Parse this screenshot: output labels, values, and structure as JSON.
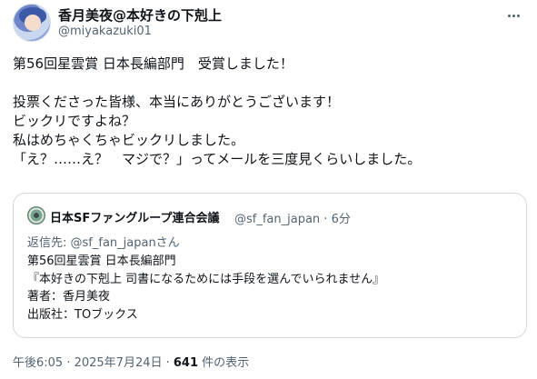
{
  "header": {
    "display_name": "香月美夜@本好きの下剋上",
    "handle": "@miyakazuki01",
    "more_icon": "more-horizontal-icon"
  },
  "tweet": {
    "lines": [
      "第56回星雲賞 日本長編部門　受賞しました！",
      "",
      "投票くださった皆様、本当にありがとうございます！",
      "ビックリですよね？",
      "私はめちゃくちゃビックリしました。",
      "「え？……え？　マジで？」ってメールを三度見くらいしました。"
    ]
  },
  "quote": {
    "display_name": "日本SFファングループ連合会議",
    "handle_time": "@sf_fan_japan · 6分",
    "reply_to": "返信先: @sf_fan_japanさん",
    "lines": [
      "第56回星雲賞 日本長編部門",
      "『本好きの下剋上 司書になるためには手段を選んでいられません』",
      "著者：香月美夜",
      "出版社：TOブックス"
    ]
  },
  "meta": {
    "timestamp": "午後6:05 · 2025年7月24日 · ",
    "views_count": "641",
    "views_label": " 件の表示"
  }
}
